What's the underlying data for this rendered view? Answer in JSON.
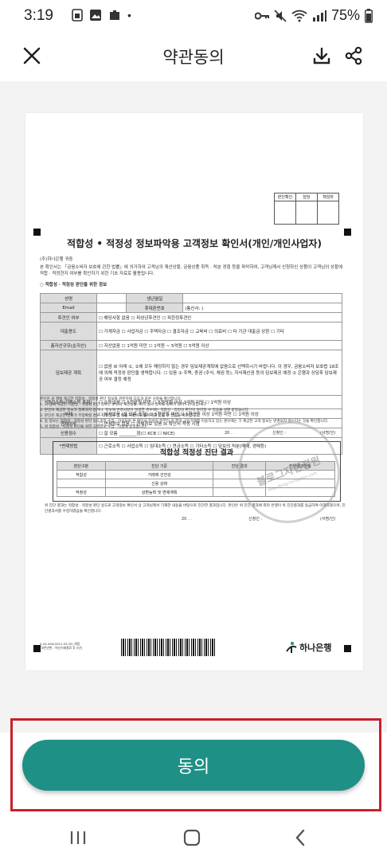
{
  "status_bar": {
    "time": "3:19",
    "battery": "75%",
    "dot": "•"
  },
  "header": {
    "title": "약관동의"
  },
  "document": {
    "approval_headers": [
      "본인확인",
      "담당",
      "책임자"
    ],
    "title": "적합성 • 적정성 정보파악용 고객정보 확인서(개인/개인사업자)",
    "addressee": "(주)하나은행 귀중",
    "intro": "본 확인서는 「금융소비자 보호에 관한 법률」에 의거하여 고객님의 재산상황, 금융상품 취득 · 처분 경험 등을 파악하여, 고객님께서 신청하신 상품이 고객님의 상황에 적합 · 적정한지 여부를 확인하기 위한 기초 자료로 활용됩니다.",
    "section": "○ 적합성 · 적정성 판단을 위한 정보",
    "rows": [
      {
        "label": "성명",
        "value": "",
        "label2": "생년월일",
        "value2": ""
      },
      {
        "label": "Email",
        "value": "",
        "label2": "휴대폰번호",
        "value2": "(통신사:          )"
      },
      {
        "label": "후견인 여부",
        "value": "☐ 해당사항 없음   ☐ 피성년후견인   ☐ 피한정후견인"
      },
      {
        "label": "대출용도",
        "value": "☐ 가계자금  ☐ 사업자금  ☐ 주택자금  ☐ 결조자금  ☐ 교육비  ☐ 의료비  ☐ 타 기관 대출금 상환  ☐ 기타"
      },
      {
        "label": "총자산규모(순자산)",
        "value": "☐ 자산없음  ☐ 1억원 미만  ☐ 1억원 ~ 5억원  ☐ 5억원 이상"
      },
      {
        "label": "담보제공 계획",
        "value": "☐ 없음  ☒ 아래 ①, ②에 모두 해당하지 않는 경우 담보제공계획에 없음으로 선택하시기 바랍니다. 이 경우, 금융소비자 보호법 18조에 의해 적정성 판단을 생략합니다.  ☐ 있음  ① 주택, 증권 (주식, 채권 등), 지식재산권 등의 담보제공 예정  ② 은행과 상담후 담보제공 여부 결정 예정"
      },
      {
        "label": "*연간소득(가족소득 포함)",
        "value": "☐ 소득없음  ☐ 5천만원 미만  ☐ 5천만원 이상 1억원 미만  ☐ 1억원 이상"
      },
      {
        "label": "부채",
        "value": "☐ 부채없음 (잘 모름 포함)  ☐ 5천만원 미만  ☐ 5천만원 이상 1억원 미만  ☐ 1억원 이상"
      },
      {
        "label": "연체여부",
        "value": "☐ 연체정보 없음  ☐ 연체정보 있음  ☒ 확인서 작성 시점"
      },
      {
        "label": "신용점수",
        "value": "☐ 잘 모름 ________점(☐ KCB  ☐ NICE)"
      },
      {
        "label": "*변제방법",
        "value": "☐ 근로소득  ☐ 사업소득  ☐ 임대소득  ☐ 연금소득  ☐ 기타소득  ☐ 담보의 처분(매매, 경매등)"
      }
    ],
    "notes": [
      "본인은 귀 행에 제공한 적합성 · 적정성 판단 정보와 관련하여 다음과 같은 사항을 확인합니다.",
      "1. 귀 행에 제공한 적합성 · 적정성 판단 정보는 본인의 재산상황, 취득 등의 정보를 정확히 알려드린 것입니다.",
      "2. 본인이 제공한 정보가 정확하지 않거나, 정보에 변경사항이 발생한 경우에는 적합성 · 적정성 판단이 달라질 수 있음을 설명 받았습니다.",
      "3. 본인은 제공한 정보가 부정확할 경우, 대출심사 및 대출거래 이후 불이익을 받을 수 있음을 확인합니다.",
      "4. 동 정보는 적합성 · 적정성 판단 용도로만 수집 · 이용되며 본 확인서 작성일 전부터 귀 행과 금융거래를 이용하고 있는 경우에는 기 제공한 고객 정보는 변경되지 않는다는 것을 확인합니다.",
      "5. 위 적합성 · 적정성 판단을 위한 고객정보 수집 · 이용에 동의합니다."
    ],
    "sign_date": "20      .      .",
    "applicant": "신청인 :",
    "sign_mark": "(서명/인)",
    "diag_title": "적합성 적정성 진단 결과",
    "diag_headers": [
      "판단구분",
      "진단 기준",
      "진단 결과",
      "진단결과번호"
    ],
    "diag_rows": [
      [
        "적합성",
        "거래에 건전성",
        "",
        ""
      ],
      [
        "",
        "신용 상태",
        "",
        ""
      ],
      [
        "적정성",
        "상환능력 및 변제계획",
        "",
        ""
      ]
    ],
    "diag_note": "위 진단 결과는 적합성 · 적정성 판단 용도로 고객정보 확인서 상 고객님께서 기재한 내용을 바탕으로 진단한 결과입니다. 본인은 위 진단 결과에 따라 은행이 위 진단결과를 등급하여 이해하였으며, 진단결과서를 수령하였음을 확인합니다.",
    "diag_date": "20      .      .",
    "diag_applicant": "신청인 :",
    "diag_sign": "(서명/인)",
    "form_code": "5-04-494(2021.03.25) 개정",
    "form_code2": "(보존년한 : 여신거래종료 후 5년)",
    "bank": "하나은행",
    "watermark_line1": "블로그자현정원",
    "watermark_line2": "http://blog.hungyeon.com"
  },
  "footer": {
    "agree_label": "동의"
  }
}
